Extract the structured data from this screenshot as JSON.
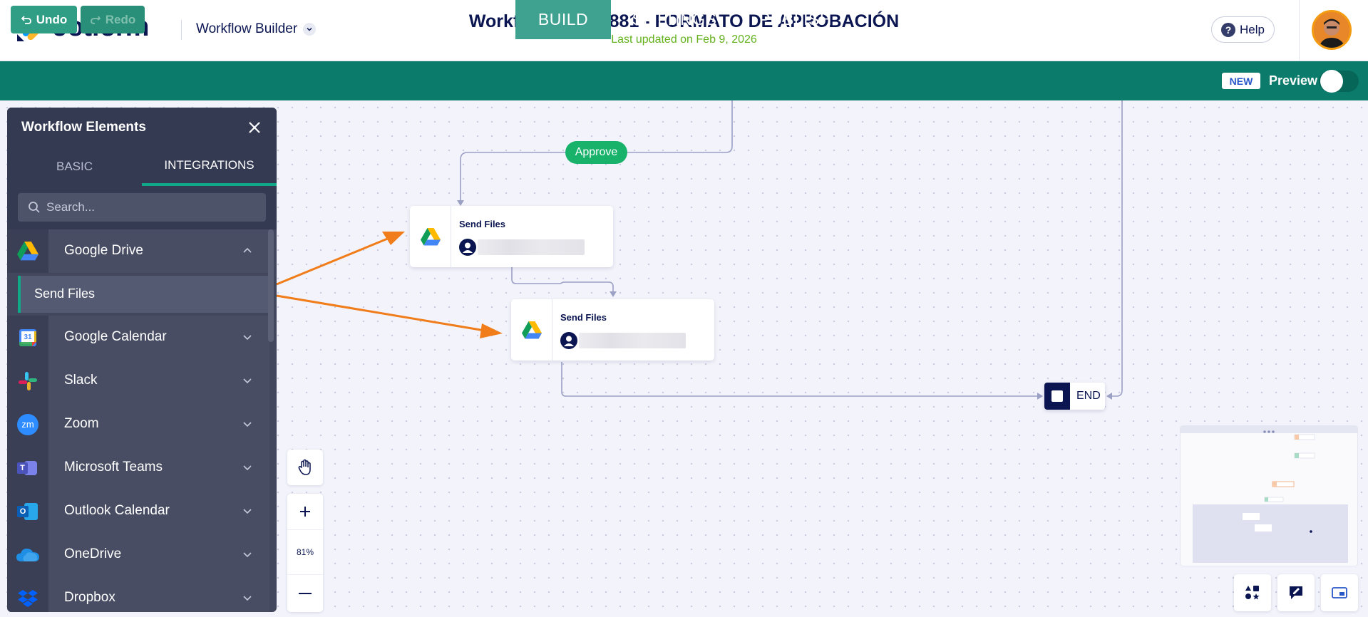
{
  "app": {
    "brand": "Jotform",
    "section": "Workflow Builder"
  },
  "workflow": {
    "title": "Workflow: 35478881 - FORMATO DE APROBACIÓN",
    "updated": "Last updated on Feb 9, 2026"
  },
  "header": {
    "help_label": "Help",
    "help_glyph": "?"
  },
  "toolbar": {
    "undo_label": "Undo",
    "redo_label": "Redo",
    "new_badge": "NEW",
    "preview_label": "Preview"
  },
  "tabs": [
    {
      "label": "BUILD",
      "active": true
    },
    {
      "label": "SETTINGS"
    },
    {
      "label": "PUBLISH"
    }
  ],
  "panel": {
    "title": "Workflow Elements",
    "tabs": [
      {
        "label": "BASIC"
      },
      {
        "label": "INTEGRATIONS",
        "active": true
      }
    ],
    "search_placeholder": "Search...",
    "items": [
      {
        "label": "Google Drive",
        "icon": "google-drive-icon",
        "expanded": true,
        "sub_items": [
          {
            "label": "Send Files"
          }
        ]
      },
      {
        "label": "Google Calendar",
        "icon": "google-calendar-icon",
        "badge": "31"
      },
      {
        "label": "Slack",
        "icon": "slack-icon"
      },
      {
        "label": "Zoom",
        "icon": "zoom-icon",
        "badge": "zm"
      },
      {
        "label": "Microsoft Teams",
        "icon": "microsoft-teams-icon",
        "badge": "T"
      },
      {
        "label": "Outlook Calendar",
        "icon": "outlook-calendar-icon",
        "badge": "O"
      },
      {
        "label": "OneDrive",
        "icon": "onedrive-icon"
      },
      {
        "label": "Dropbox",
        "icon": "dropbox-icon"
      }
    ]
  },
  "canvas": {
    "approve_label": "Approve",
    "nodes": [
      {
        "title": "Send Files"
      },
      {
        "title": "Send Files"
      }
    ],
    "end_label": "END",
    "zoom_level": "81%",
    "annotation_color": "#f07d1a"
  },
  "colors": {
    "brand_teal": "#0b7c6b",
    "approve_green": "#18b26b",
    "navy": "#0a1551",
    "updated_green": "#64b21e"
  }
}
